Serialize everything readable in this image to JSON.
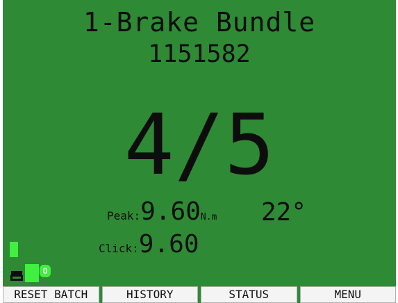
{
  "screen": {
    "title": "1-Brake Bundle",
    "code": "1151582",
    "count": "4/5",
    "peak": {
      "label": "Peak:",
      "value": "9.60",
      "unit": "N.m"
    },
    "angle": "22°",
    "click": {
      "label": "Click:",
      "value": "9.60"
    },
    "status_badge": "0"
  },
  "softkeys": [
    {
      "label": "RESET BATCH"
    },
    {
      "label": "HISTORY"
    },
    {
      "label": "STATUS"
    },
    {
      "label": "MENU"
    }
  ],
  "colors": {
    "screen_bg": "#2e8a34",
    "indicator": "#3ff03f",
    "softkey_bg": "#f4f4f4"
  },
  "icons": [
    "battery-icon",
    "signal-indicator-icon"
  ]
}
